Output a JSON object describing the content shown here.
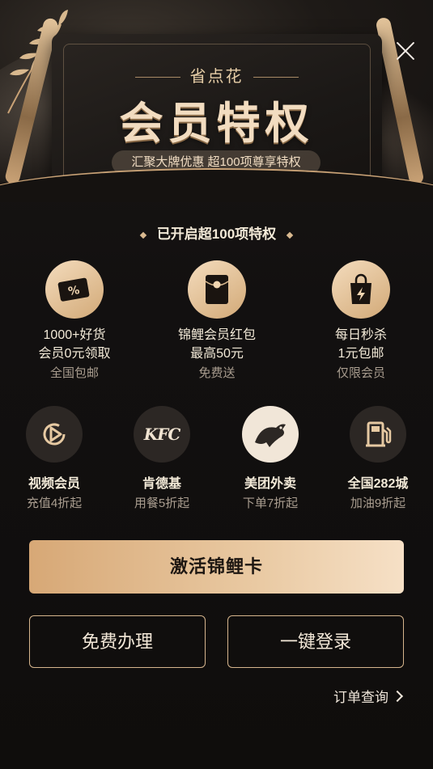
{
  "hero": {
    "brand": "省点花",
    "title": "会员特权",
    "subtitle": "汇聚大牌优惠 超100项尊享特权"
  },
  "section_title": "已开启超100项特权",
  "perks": [
    {
      "icon": "discount-ticket-icon",
      "line1": "1000+好货",
      "line2": "会员0元领取",
      "line3": "全国包邮"
    },
    {
      "icon": "red-envelope-icon",
      "line1": "锦鲤会员红包",
      "line2": "最高50元",
      "line3": "免费送"
    },
    {
      "icon": "shopping-bag-flash-icon",
      "line1": "每日秒杀",
      "line2": "1元包邮",
      "line3": "仅限会员"
    }
  ],
  "partners": [
    {
      "icon": "video-play-icon",
      "name": "视频会员",
      "desc": "充值4折起"
    },
    {
      "icon": "kfc-logo-icon",
      "logo_text": "KFC",
      "name": "肯德基",
      "desc": "用餐5折起"
    },
    {
      "icon": "meituan-kangaroo-icon",
      "name": "美团外卖",
      "desc": "下单7折起"
    },
    {
      "icon": "fuel-pump-icon",
      "name": "全国282城",
      "desc": "加油9折起"
    }
  ],
  "buttons": {
    "activate": "激活锦鲤卡",
    "free_apply": "免费办理",
    "quick_login": "一键登录"
  },
  "order_query": "订单查询",
  "colors": {
    "gold_light": "#f6e0c6",
    "gold": "#d7a876",
    "background": "#0f0d0c"
  }
}
